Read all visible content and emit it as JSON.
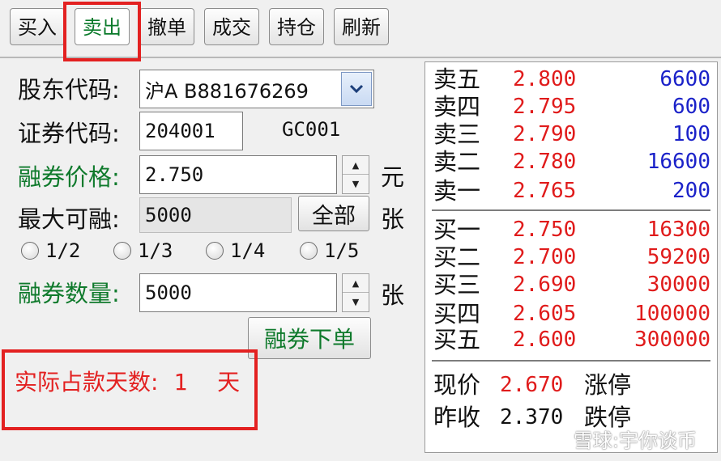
{
  "toolbar": {
    "tabs": [
      {
        "label": "买入"
      },
      {
        "label": "卖出"
      },
      {
        "label": "撤单"
      },
      {
        "label": "成交"
      },
      {
        "label": "持仓"
      },
      {
        "label": "刷新"
      }
    ]
  },
  "form": {
    "account_label": "股东代码:",
    "account_value": "沪A B881676269",
    "code_label": "证券代码:",
    "code_value": "204001",
    "code_name": "GC001",
    "price_label": "融券价格:",
    "price_value": "2.750",
    "price_unit": "元",
    "max_label": "最大可融:",
    "max_value": "5000",
    "all_button": "全部",
    "max_unit": "张",
    "ratios": [
      "1/2",
      "1/3",
      "1/4",
      "1/5"
    ],
    "qty_label": "融券数量:",
    "qty_value": "5000",
    "qty_unit": "张",
    "submit_button": "融券下单",
    "days_label": "实际占款天数:",
    "days_value": "1",
    "days_unit": "天"
  },
  "quotes": {
    "sell": [
      {
        "label": "卖五",
        "price": "2.800",
        "volume": "6600"
      },
      {
        "label": "卖四",
        "price": "2.795",
        "volume": "600"
      },
      {
        "label": "卖三",
        "price": "2.790",
        "volume": "100"
      },
      {
        "label": "卖二",
        "price": "2.780",
        "volume": "16600"
      },
      {
        "label": "卖一",
        "price": "2.765",
        "volume": "200"
      }
    ],
    "buy": [
      {
        "label": "买一",
        "price": "2.750",
        "volume": "16300"
      },
      {
        "label": "买二",
        "price": "2.700",
        "volume": "59200"
      },
      {
        "label": "买三",
        "price": "2.690",
        "volume": "30000"
      },
      {
        "label": "买四",
        "price": "2.605",
        "volume": "100000"
      },
      {
        "label": "买五",
        "price": "2.600",
        "volume": "300000"
      }
    ],
    "current_label": "现价",
    "current_value": "2.670",
    "limit_up_label": "涨停",
    "prev_close_label": "昨收",
    "prev_close_value": "2.370",
    "limit_down_label": "跌停"
  },
  "watermark": "雪球:宇你谈币",
  "colors": {
    "price_red": "#e01b1b",
    "sell_volume_blue": "#1b22c9",
    "label_green": "#0f7a2c",
    "highlight_box": "#e32121"
  }
}
